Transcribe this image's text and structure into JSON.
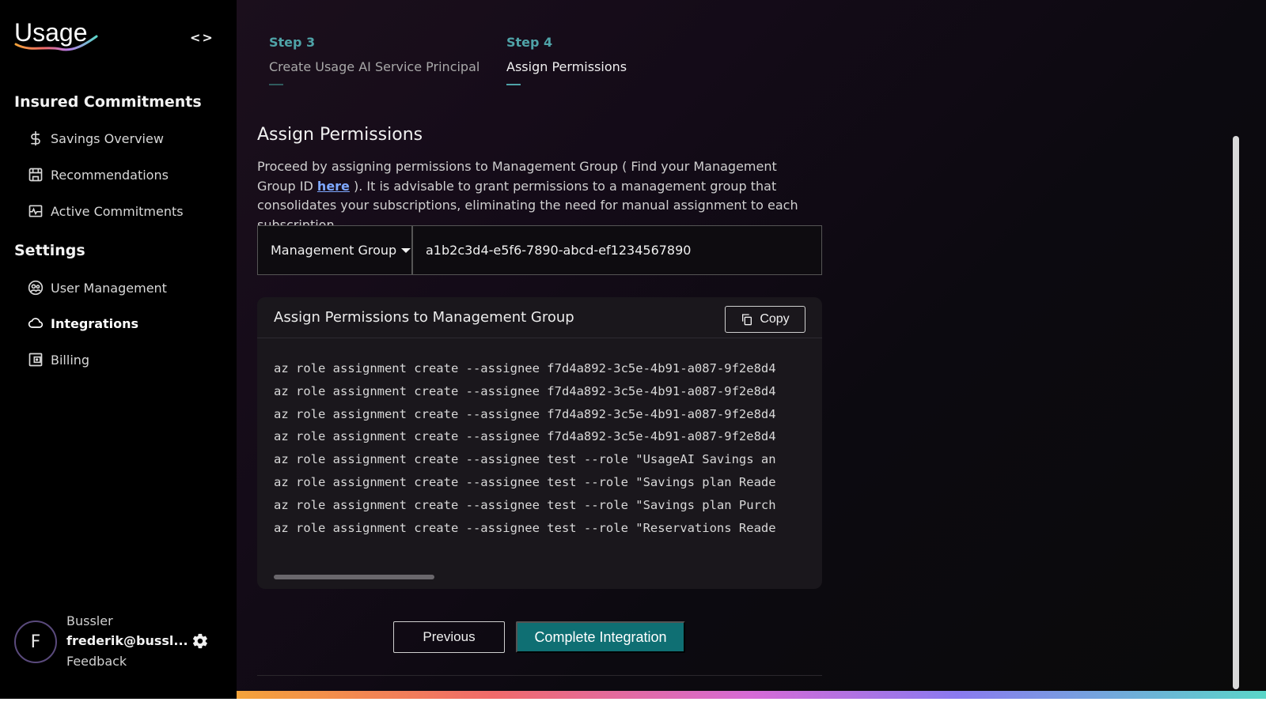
{
  "app": {
    "logo_text": "Usage"
  },
  "sidebar": {
    "collapse_label": "<>",
    "sections": [
      {
        "title": "Insured Commitments"
      },
      {
        "title": "Settings"
      }
    ],
    "items": [
      {
        "label": "Savings Overview",
        "icon": "dollar-icon"
      },
      {
        "label": "Recommendations",
        "icon": "store-icon"
      },
      {
        "label": "Active Commitments",
        "icon": "activity-icon"
      },
      {
        "label": "User Management",
        "icon": "users-icon"
      },
      {
        "label": "Integrations",
        "icon": "cloud-icon",
        "active": true
      },
      {
        "label": "Billing",
        "icon": "wallet-icon"
      }
    ]
  },
  "user": {
    "initial": "F",
    "name": "Bussler",
    "email": "frederik@bussl...",
    "feedback": "Feedback"
  },
  "steps": [
    {
      "number": "Step 3",
      "label": "Create Usage AI Service Principal"
    },
    {
      "number": "Step 4",
      "label": "Assign Permissions"
    }
  ],
  "main": {
    "title": "Assign Permissions",
    "desc_part1": "Proceed by assigning permissions to Management Group ( Find your Management Group ID ",
    "desc_link": "here",
    "desc_part2": " ). It is advisable to grant permissions to a management group that consolidates your subscriptions, eliminating the need for manual assignment to each subscription.",
    "scope_select": "Management Group",
    "scope_id_value": "a1b2c3d4-e5f6-7890-abcd-ef1234567890",
    "code_title": "Assign Permissions to Management Group",
    "copy_label": "Copy",
    "code_lines": [
      "az role assignment create --assignee f7d4a892-3c5e-4b91-a087-9f2e8d4",
      "az role assignment create --assignee f7d4a892-3c5e-4b91-a087-9f2e8d4",
      "az role assignment create --assignee f7d4a892-3c5e-4b91-a087-9f2e8d4",
      "az role assignment create --assignee f7d4a892-3c5e-4b91-a087-9f2e8d4",
      "az role assignment create --assignee test --role \"UsageAI Savings an",
      "az role assignment create --assignee test --role \"Savings plan Reade",
      "az role assignment create --assignee test --role \"Savings plan Purch",
      "az role assignment create --assignee test --role \"Reservations Reade"
    ],
    "prev_label": "Previous",
    "complete_label": "Complete Integration"
  },
  "colors": {
    "accent": "#4fa3a8",
    "primary_button": "#0f6f73",
    "link": "#7ea8ff"
  }
}
